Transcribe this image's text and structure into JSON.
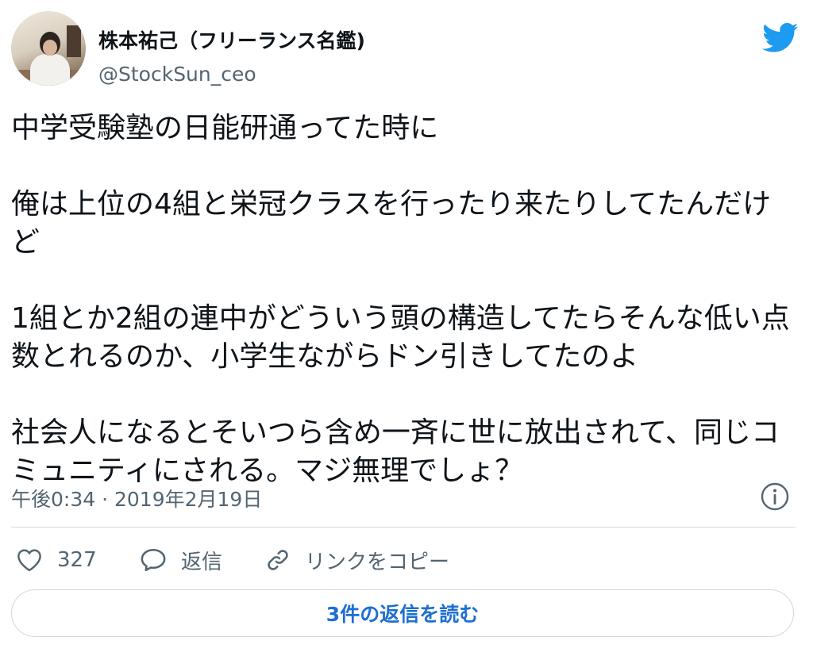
{
  "user": {
    "display_name": "株本祐己（フリーランス名鑑)",
    "handle": "@StockSun_ceo"
  },
  "tweet": {
    "paragraphs": [
      "中学受験塾の日能研通ってた時に",
      "俺は上位の4組と栄冠クラスを行ったり来たりしてたんだけど",
      "1組とか2組の連中がどういう頭の構造してたらそんな低い点数とれるのか、小学生ながらドン引きしてたのよ",
      "社会人になるとそいつら含め一斉に世に放出されて、同じコミュニティにされる。マジ無理でしょ？"
    ],
    "timestamp": "午後0:34 · 2019年2月19日"
  },
  "actions": {
    "like_count": "327",
    "reply_label": "返信",
    "copy_link_label": "リンクをコピー"
  },
  "read_replies_label": "3件の返信を読む",
  "colors": {
    "twitter_blue": "#1d9bf0",
    "link_blue": "#1d6fd1",
    "secondary_text": "#536471",
    "border": "#cfd9de"
  },
  "icons": {
    "brand": "twitter-bird-icon",
    "info": "info-icon",
    "like": "heart-icon",
    "reply": "speech-bubble-icon",
    "copy_link": "link-icon"
  }
}
